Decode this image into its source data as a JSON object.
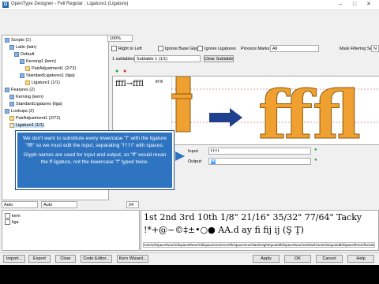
{
  "window": {
    "title": "OpenType Designer - Fell Regular : Ligature1 (Ligature)",
    "minimize": "–",
    "maximize": "□",
    "close": "✕"
  },
  "tree": {
    "items": [
      {
        "label": "Scripts (1)",
        "indent": 0
      },
      {
        "label": "Latin (latn)",
        "indent": 1
      },
      {
        "label": "Default",
        "indent": 2
      },
      {
        "label": "Kerning1 (kern)",
        "indent": 3
      },
      {
        "label": "PairAdjustment1 (2/72)",
        "indent": 4
      },
      {
        "label": "StandardLigatures1 (liga)",
        "indent": 3
      },
      {
        "label": "Ligature1 (1/1)",
        "indent": 4
      },
      {
        "label": "Features (2)",
        "indent": 0
      },
      {
        "label": "Kerning (kern)",
        "indent": 1
      },
      {
        "label": "StandardLigatures (liga)",
        "indent": 1
      },
      {
        "label": "Lookups (2)",
        "indent": 0
      },
      {
        "label": "PairAdjustment1 (2/72)",
        "indent": 1
      },
      {
        "label": "Ligature1 (1/1)",
        "indent": 1
      }
    ]
  },
  "toolbar": {
    "zoom": "100%",
    "right_to_left": "Right to Left",
    "ignore_base_glyphs": "Ignore Base Glyphs",
    "ignore_ligatures": "Ignore Ligatures",
    "process_marks_label": "Process Marks:",
    "process_marks_value": "All",
    "mark_filtering_label": "Mark Filtering Set:",
    "mark_filtering_value": "N",
    "subtables_label": "1 subtables:",
    "subtable_value": "Subtable 1 (1/1)",
    "clear_subtable": "Clear Subtable"
  },
  "glyph_list": {
    "entry": "fffl→fffl",
    "small_names": "ffff ffl"
  },
  "editor": {
    "input_label": "Input:",
    "input_value": "f f f l",
    "output_label": "Output:",
    "output_value": "fffl"
  },
  "callout": {
    "para1": "We don't want to substitute every lowercase \"f\" with the ligature \"fffl\" so we must edit the input, separating \"f f f l\" with spaces.",
    "para2": "Glyph names are used for input and output, so \"ff\" would mean the ff ligature, not the lowercase \"f\" typed twice."
  },
  "preview_controls": {
    "combo1": "Auto",
    "combo2": "Auto",
    "size": "24"
  },
  "features_list": [
    "kern",
    "liga"
  ],
  "preview": {
    "line1": "1st 2nd 3rd 10th 1/8\" 21/16\" 35/32\" 77/64\" Tacky",
    "line2": "!*+@~©‡±•○● AA.d ay fi fij ij (Ş Ţ)",
    "path_text": "/one/s/t/space/two/n/d/space/three/r/d/space/one/zero/t/h/space/one/slash/eight/quotedbl/space/two/one/slash/one/six/quotedbl/space/three/five/slash/three/two"
  },
  "buttons": {
    "import": "Import...",
    "export": "Export",
    "clear": "Clear",
    "code_editor": "Code Editor...",
    "kern_wizard": "Kern Wizard...",
    "apply": "Apply",
    "ok": "OK",
    "cancel": "Cancel",
    "help": "Help"
  },
  "colors": {
    "callout_bg": "#2e74c0",
    "glyph_fill": "#f0a030",
    "arrow": "#1f3f8f"
  }
}
